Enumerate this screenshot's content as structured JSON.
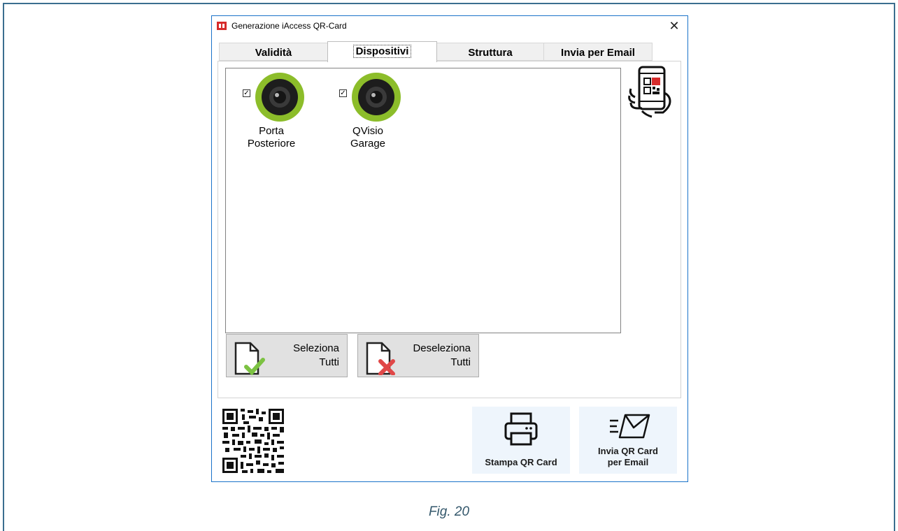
{
  "window": {
    "title": "Generazione iAccess QR-Card",
    "close_label": "✕"
  },
  "tabs": [
    {
      "label": "Validità",
      "active": false
    },
    {
      "label": "Dispositivi",
      "active": true
    },
    {
      "label": "Struttura",
      "active": false
    },
    {
      "label": "Invia per Email",
      "active": false
    }
  ],
  "devices": [
    {
      "label": "Porta\nPosteriore",
      "checked": true,
      "icon": "camera-icon"
    },
    {
      "label": "QVisio\nGarage",
      "checked": true,
      "icon": "camera-icon"
    }
  ],
  "buttons": {
    "select_all": "Seleziona\nTutti",
    "deselect_all": "Deseleziona\nTutti",
    "print": "Stampa QR Card",
    "email": "Invia QR Card\nper Email"
  },
  "caption": "Fig. 20",
  "colors": {
    "window_border": "#1a73c9",
    "camera_ring": "#8cbd2a",
    "action_bg": "#eef5fc",
    "check_green": "#7cc242",
    "cross_red": "#e04848"
  }
}
